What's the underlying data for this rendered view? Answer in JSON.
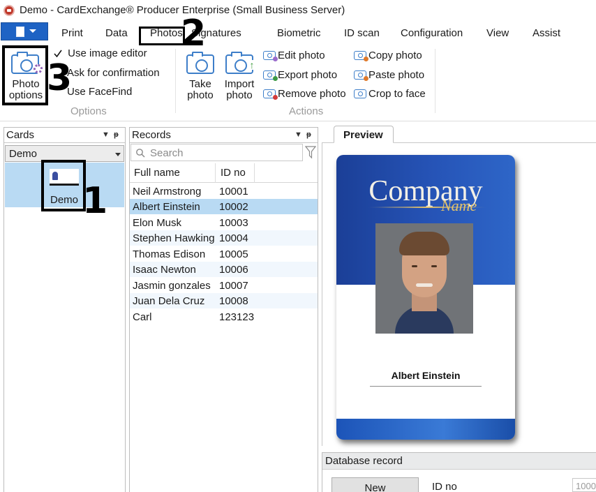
{
  "window": {
    "title": "Demo - CardExchange® Producer Enterprise (Small Business Server)"
  },
  "ribbon": {
    "tabs": [
      "Print",
      "Data",
      "Photos",
      "Signatures",
      "Biometric",
      "ID scan",
      "Configuration",
      "View",
      "Assist"
    ],
    "photo_options_label": [
      "Photo",
      "options"
    ],
    "options": {
      "use_image_editor": "Use image editor",
      "use_image_editor_checked": true,
      "ask_for_confirmation": "Ask for confirmation",
      "use_facefind": "Use FaceFind",
      "group_label": "Options"
    },
    "actions": {
      "take_photo": [
        "Take",
        "photo"
      ],
      "import_photo": [
        "Import",
        "photo"
      ],
      "edit_photo": "Edit photo",
      "export_photo": "Export photo",
      "remove_photo": "Remove photo",
      "copy_photo": "Copy photo",
      "paste_photo": "Paste photo",
      "crop_to_face": "Crop to face",
      "group_label": "Actions"
    }
  },
  "annotations": {
    "step1": "1",
    "step2": "2",
    "step3": "3"
  },
  "cards_panel": {
    "title": "Cards",
    "selected_card": "Demo",
    "card_item_label": "Demo"
  },
  "records_panel": {
    "title": "Records",
    "search_placeholder": "Search",
    "columns": [
      "Full name",
      "ID no"
    ],
    "rows": [
      {
        "name": "Neil Armstrong",
        "id": "10001"
      },
      {
        "name": "Albert Einstein",
        "id": "10002"
      },
      {
        "name": "Elon Musk",
        "id": "10003"
      },
      {
        "name": "Stephen Hawking",
        "id": "10004"
      },
      {
        "name": "Thomas Edison",
        "id": "10005"
      },
      {
        "name": "Isaac Newton",
        "id": "10006"
      },
      {
        "name": "Jasmin gonzales",
        "id": "10007"
      },
      {
        "name": "Juan Dela Cruz",
        "id": "10008"
      },
      {
        "name": "Carl",
        "id": "123123"
      }
    ],
    "selected_index": 1
  },
  "preview": {
    "tab_label": "Preview",
    "card_logo_main": "Company",
    "card_logo_sub": "Name",
    "card_name": "Albert Einstein"
  },
  "database_record": {
    "title": "Database record",
    "new_button": "New",
    "id_label": "ID no",
    "id_value": "1000"
  }
}
